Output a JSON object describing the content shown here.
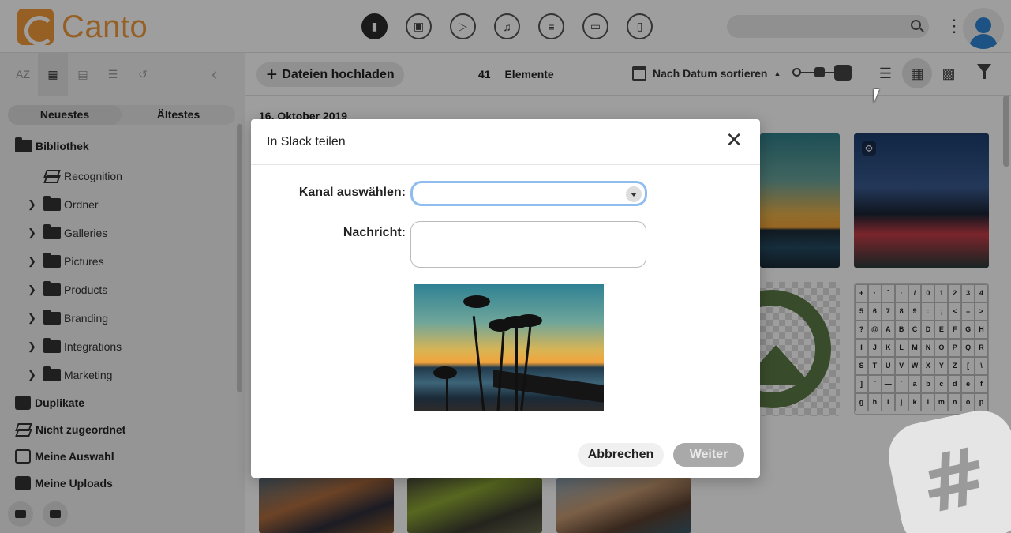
{
  "header": {
    "logo_text": "Canto",
    "type_icons": [
      "all-files",
      "images",
      "video",
      "audio",
      "documents",
      "presentations",
      "other-files"
    ],
    "search_placeholder": ""
  },
  "sidebar": {
    "sort_tools": [
      "AZ",
      "calendar",
      "size",
      "list",
      "undo"
    ],
    "age_tabs": [
      "Neuestes",
      "Ältestes"
    ],
    "library_label": "Bibliothek",
    "tree": [
      {
        "label": "Recognition",
        "expandable": false,
        "icon": "stack-icon"
      },
      {
        "label": "Ordner",
        "expandable": true,
        "icon": "folder-icon"
      },
      {
        "label": "Galleries",
        "expandable": true,
        "icon": "folder-icon"
      },
      {
        "label": "Pictures",
        "expandable": true,
        "icon": "folder-icon"
      },
      {
        "label": "Products",
        "expandable": true,
        "icon": "folder-icon"
      },
      {
        "label": "Branding",
        "expandable": true,
        "icon": "folder-icon"
      },
      {
        "label": "Integrations",
        "expandable": true,
        "icon": "folder-icon"
      },
      {
        "label": "Marketing",
        "expandable": true,
        "icon": "folder-icon"
      }
    ],
    "sections": [
      "Duplikate",
      "Nicht zugeordnet",
      "Meine Auswahl",
      "Meine Uploads"
    ]
  },
  "toolbar": {
    "upload_label": "Dateien hochladen",
    "count": "41",
    "count_label": "Elemente",
    "sort_label": "Nach Datum sortieren",
    "sort_direction": "▲"
  },
  "content": {
    "date_header": "16. Oktober 2019",
    "glyphs": [
      "+",
      "·",
      "ˆ",
      "·",
      "/",
      "0",
      "1",
      "2",
      "3",
      "4",
      "5",
      "6",
      "7",
      "8",
      "9",
      ":",
      ";",
      "<",
      "=",
      ">",
      "?",
      "@",
      "A",
      "B",
      "C",
      "D",
      "E",
      "F",
      "G",
      "H",
      "I",
      "J",
      "K",
      "L",
      "M",
      "N",
      "O",
      "P",
      "Q",
      "R",
      "S",
      "T",
      "U",
      "V",
      "W",
      "X",
      "Y",
      "Z",
      "[",
      "\\",
      "]",
      "˜",
      "—",
      "`",
      "a",
      "b",
      "c",
      "d",
      "e",
      "f",
      "g",
      "h",
      "i",
      "j",
      "k",
      "l",
      "m",
      "n",
      "o",
      "p"
    ]
  },
  "dialog": {
    "title": "In Slack teilen",
    "channel_label": "Kanal auswählen:",
    "channel_value": "",
    "message_label": "Nachricht:",
    "message_value": "",
    "cancel_label": "Abbrechen",
    "next_label": "Weiter"
  },
  "colors": {
    "brand": "#f39a3a",
    "select_focus": "#8fbdf0",
    "disabled_button": "#a9a9a9"
  }
}
